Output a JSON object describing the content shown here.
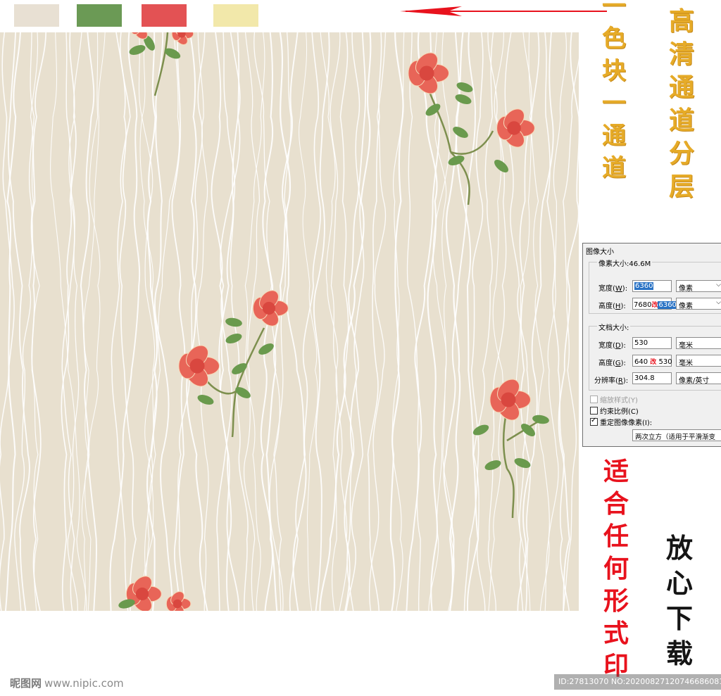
{
  "swatches": [
    {
      "name": "beige",
      "color": "#e8e0d3"
    },
    {
      "name": "green",
      "color": "#6b9a55"
    },
    {
      "name": "red",
      "color": "#e35254"
    },
    {
      "name": "cream",
      "color": "#f2e8aa"
    }
  ],
  "colors": {
    "pattern_bg": "#e8e0cf",
    "line": "#ffffff",
    "petal": "#e86558",
    "leaf": "#6a9a4d",
    "arrow": "#e8121d",
    "gold_text": "#e6ab28"
  },
  "annotations": {
    "one_color_one_channel": [
      "一",
      "色",
      "块",
      "一",
      "通",
      "道"
    ],
    "hd_channel_layers": [
      "高",
      "清",
      "通",
      "道",
      "分",
      "层"
    ],
    "suitable_any_print": [
      "适",
      "合",
      "任",
      "何",
      "形",
      "式",
      "印"
    ],
    "download_safely": [
      "放",
      "心",
      "下",
      "载"
    ]
  },
  "dialog": {
    "title": "图像大小",
    "pixel_size": "像素大小:46.6M",
    "width_label": "宽度(",
    "width_key": "W",
    "width_value": "6360",
    "width_unit": "像素",
    "height_label": "高度(",
    "height_key": "H",
    "height_value": "7680",
    "height_note": "改",
    "height_new": "6360",
    "height_unit": "像素",
    "doc_size": "文档大小:",
    "doc_width_label": "宽度(",
    "doc_width_key": "D",
    "doc_width_value": "530",
    "doc_width_unit": "毫米",
    "doc_height_label": "高度(",
    "doc_height_key": "G",
    "doc_height_value": "640",
    "doc_height_note": "改",
    "doc_height_new": "530",
    "doc_height_unit": "毫米",
    "resolution_label": "分辨率(",
    "resolution_key": "R",
    "resolution_value": "304.8",
    "resolution_unit": "像素/英寸",
    "scale_styles": "缩放样式(Y)",
    "constrain": "约束比例(C)",
    "resample": "重定图像像素(I):",
    "resample_method": "两次立方（适用于平滑渐变"
  },
  "watermark": {
    "logo": "昵图网",
    "site": "www.nipic.com",
    "id_text": "ID:27813070 NO:20200827120746686081"
  }
}
